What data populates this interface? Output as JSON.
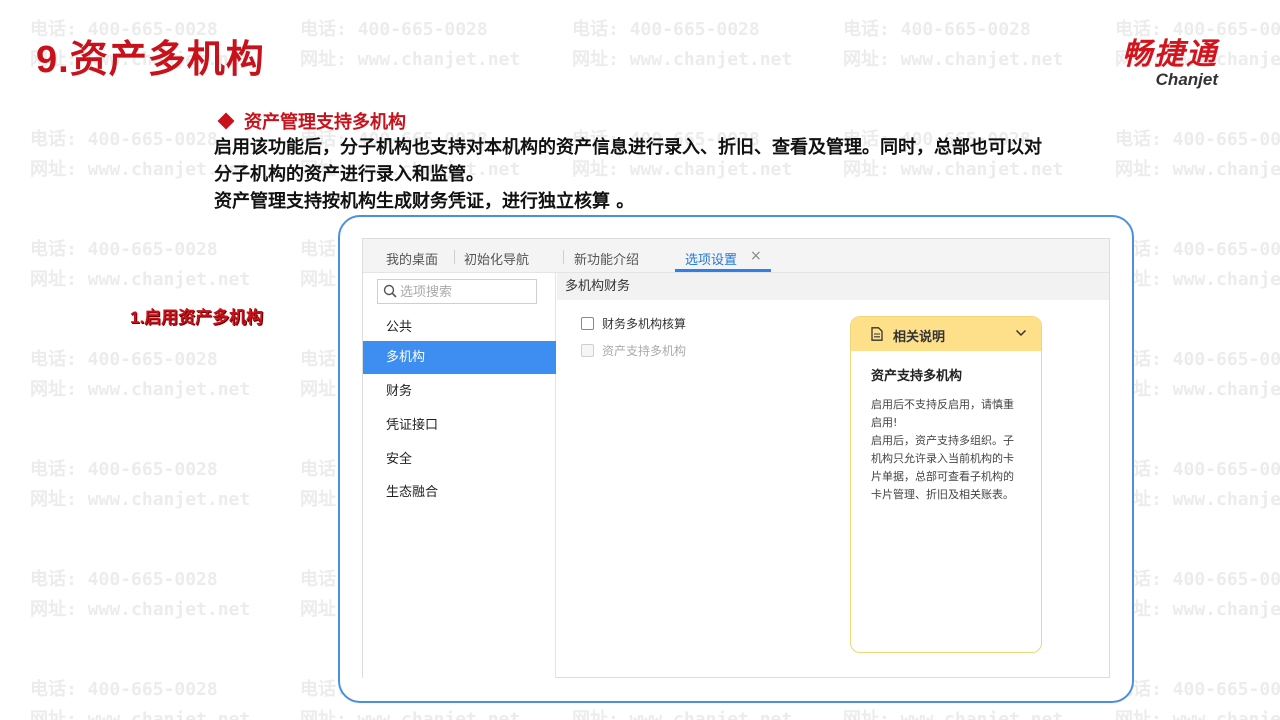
{
  "slide": {
    "title_num": "9.",
    "title_text": "资产多机构"
  },
  "logo": {
    "cn": "畅捷通",
    "en": "Chanjet"
  },
  "watermark": {
    "phone": "电话: 400-665-0028",
    "site": "网址: www.chanjet.net"
  },
  "description": {
    "bullet": "资产管理支持多机构",
    "line1": "启用该功能后，分子机构也支持对本机构的资产信息进行录入、折旧、查看及管理。同时，总部也可以对",
    "line2": "分子机构的资产进行录入和监管。",
    "line3": "资产管理支持按机构生成财务凭证，进行独立核算 。"
  },
  "step_label": "1.启用资产多机构",
  "app": {
    "tabs": [
      {
        "label": "我的桌面"
      },
      {
        "label": "初始化导航"
      },
      {
        "label": "新功能介绍"
      },
      {
        "label": "选项设置",
        "active": true
      }
    ],
    "close_glyph": "×",
    "search": {
      "placeholder": "选项搜索"
    },
    "sidebar": [
      {
        "label": "公共"
      },
      {
        "label": "多机构",
        "active": true
      },
      {
        "label": "财务"
      },
      {
        "label": "凭证接口"
      },
      {
        "label": "安全"
      },
      {
        "label": "生态融合"
      }
    ],
    "section_title": "多机构财务",
    "options": [
      {
        "label": "财务多机构核算",
        "checked": false,
        "disabled": false
      },
      {
        "label": "资产支持多机构",
        "checked": false,
        "disabled": true
      }
    ],
    "help_panel": {
      "title": "相关说明",
      "subtitle": "资产支持多机构",
      "text1": "启用后不支持反启用，请慎重启用!",
      "text2": "启用后，资产支持多组织。子机构只允许录入当前机构的卡片单据，总部可查看子机构的卡片管理、折旧及相关账表。"
    }
  },
  "colors": {
    "brand_red": "#c8121b",
    "accent_blue": "#3d8ef0",
    "panel_yellow": "#ffe08a"
  }
}
